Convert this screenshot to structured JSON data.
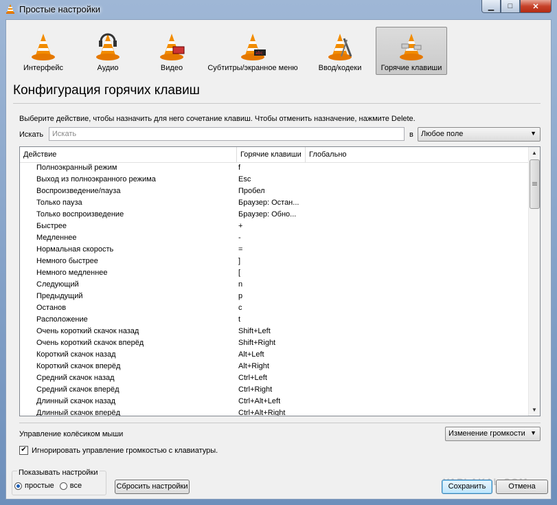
{
  "window": {
    "title": "Простые настройки"
  },
  "toolbar": [
    {
      "label": "Интерфейс",
      "icon": "cone-interface-icon",
      "active": false
    },
    {
      "label": "Аудио",
      "icon": "cone-headphones-icon",
      "active": false
    },
    {
      "label": "Видео",
      "icon": "cone-video-icon",
      "active": false
    },
    {
      "label": "Субтитры/экранное меню",
      "icon": "cone-subtitles-icon",
      "active": false
    },
    {
      "label": "Ввод/кодеки",
      "icon": "cone-codecs-icon",
      "active": false
    },
    {
      "label": "Горячие клавиши",
      "icon": "cone-hotkeys-icon",
      "active": true
    }
  ],
  "section": {
    "title": "Конфигурация горячих клавиш",
    "instructions": "Выберите действие, чтобы назначить для него сочетание клавиш. Чтобы отменить назначение, нажмите Delete."
  },
  "search": {
    "label": "Искать",
    "placeholder": "Искать",
    "in_label": "в",
    "field_value": "Любое поле"
  },
  "table": {
    "columns": [
      "Действие",
      "Горячие клавиши",
      "Глобально"
    ],
    "rows": [
      [
        "Полноэкранный режим",
        "f"
      ],
      [
        "Выход из полноэкранного режима",
        "Esc"
      ],
      [
        "Воспроизведение/пауза",
        "Пробел"
      ],
      [
        "Только пауза",
        "Браузер: Остан..."
      ],
      [
        "Только воспроизведение",
        "Браузер: Обно..."
      ],
      [
        "Быстрее",
        "+"
      ],
      [
        "Медленнее",
        "-"
      ],
      [
        "Нормальная скорость",
        "="
      ],
      [
        "Немного быстрее",
        "]"
      ],
      [
        "Немного медленнее",
        "["
      ],
      [
        "Следующий",
        "n"
      ],
      [
        "Предыдущий",
        "p"
      ],
      [
        "Останов",
        "c"
      ],
      [
        "Расположение",
        "t"
      ],
      [
        "Очень короткий скачок назад",
        "Shift+Left"
      ],
      [
        "Очень короткий скачок вперёд",
        "Shift+Right"
      ],
      [
        "Короткий скачок назад",
        "Alt+Left"
      ],
      [
        "Короткий скачок вперёд",
        "Alt+Right"
      ],
      [
        "Средний скачок назад",
        "Ctrl+Left"
      ],
      [
        "Средний скачок вперёд",
        "Ctrl+Right"
      ],
      [
        "Длинный скачок назад",
        "Ctrl+Alt+Left"
      ],
      [
        "Длинный скачок вперёд",
        "Ctrl+Alt+Right"
      ]
    ]
  },
  "wheel": {
    "label": "Управление колёсиком мыши",
    "value": "Изменение громкости"
  },
  "ignore_volume": {
    "label": "Игнорировать управление громкостью с клавиатуры.",
    "checked": true
  },
  "show_settings": {
    "title": "Показывать настройки",
    "simple": "простые",
    "all": "все",
    "selected": "простые"
  },
  "buttons": {
    "reset": "Сбросить настройки",
    "save": "Сохранить",
    "cancel": "Отмена"
  },
  "watermark": "YAPLAKAL.COM"
}
